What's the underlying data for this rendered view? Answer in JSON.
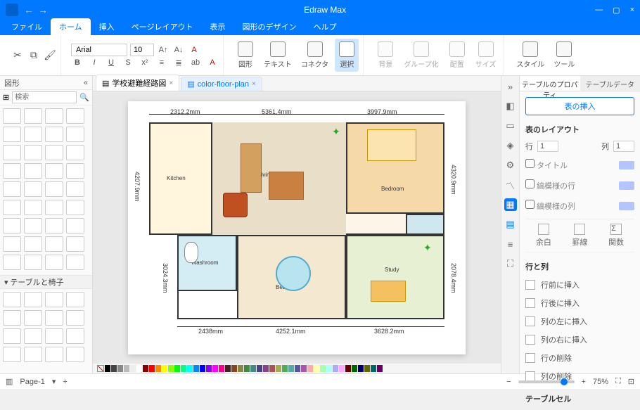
{
  "app": {
    "title": "Edraw Max"
  },
  "window_controls": {
    "minimize": "—",
    "restore": "▢",
    "close": "×"
  },
  "menu": {
    "tabs": [
      "ファイル",
      "ホーム",
      "挿入",
      "ページレイアウト",
      "表示",
      "図形のデザイン",
      "ヘルプ"
    ],
    "active": 1
  },
  "ribbon": {
    "font_name": "Arial",
    "font_size": "10",
    "format_buttons": [
      "B",
      "I",
      "U",
      "S",
      "x²",
      "x₂",
      "A"
    ],
    "big_tools": [
      {
        "label": "図形"
      },
      {
        "label": "テキスト"
      },
      {
        "label": "コネクタ"
      },
      {
        "label": "選択",
        "active": true
      }
    ],
    "arrange_tools": [
      {
        "label": "背景"
      },
      {
        "label": "グループ化"
      },
      {
        "label": "配置"
      },
      {
        "label": "サイズ"
      }
    ],
    "right_tools": [
      {
        "label": "スタイル"
      },
      {
        "label": "ツール"
      }
    ]
  },
  "left_panel": {
    "title": "図形",
    "search_placeholder": "検索",
    "section2": "テーブルと椅子"
  },
  "doc_tabs": [
    {
      "icon": "doc",
      "label": "学校避難経路図",
      "active": false
    },
    {
      "icon": "doc",
      "label": "color-floor-plan",
      "active": true
    }
  ],
  "floorplan": {
    "dims_top": [
      "2312.2mm",
      "5361.4mm",
      "3997.9mm"
    ],
    "dims_bottom": [
      "2438mm",
      "4252.1mm",
      "3628.2mm"
    ],
    "dim_left": "4207.9mm",
    "dim_left2": "3024.3mm",
    "dim_right": "4320.9mm",
    "dim_right2": "2078.4mm",
    "rooms": {
      "kitchen": "Kitchen",
      "living": "Living Room",
      "bedroom1": "Bedroom",
      "washroom": "Washroom",
      "bedroom2": "Bedroom",
      "study": "Study"
    }
  },
  "right_rail_icons": [
    "expand",
    "theme",
    "style",
    "layers",
    "settings",
    "chart",
    "table",
    "page",
    "align",
    "fullscreen"
  ],
  "right_panel": {
    "tabs": [
      "テーブルのプロパティ",
      "テーブルデータ"
    ],
    "active_tab": 0,
    "insert_btn": "表の挿入",
    "layout_header": "表のレイアウト",
    "rows_label": "行",
    "rows_value": "1",
    "cols_label": "列",
    "cols_value": "1",
    "checks": [
      {
        "label": "タイトル"
      },
      {
        "label": "縞模様の行"
      },
      {
        "label": "縞模様の列"
      }
    ],
    "icons3": [
      {
        "label": "余白"
      },
      {
        "label": "罫線"
      },
      {
        "label": "関数"
      }
    ],
    "rowcol_header": "行と列",
    "rowcol_ops": [
      "行前に挿入",
      "行後に挿入",
      "列の左に挿入",
      "列の右に挿入",
      "行の削除",
      "列の削除"
    ],
    "cell_header": "テーブルセル"
  },
  "statusbar": {
    "page_label": "Page-1",
    "add_page": "+",
    "zoom": "75%"
  },
  "color_palette": [
    "#000",
    "#444",
    "#888",
    "#bbb",
    "#eee",
    "#fff",
    "#800",
    "#f00",
    "#f80",
    "#ff0",
    "#8f0",
    "#0f0",
    "#0f8",
    "#0ff",
    "#08f",
    "#00f",
    "#80f",
    "#f0f",
    "#f08",
    "#422",
    "#842",
    "#884",
    "#484",
    "#488",
    "#448",
    "#848",
    "#a55",
    "#aa5",
    "#5a5",
    "#5aa",
    "#55a",
    "#a5a",
    "#faa",
    "#ffa",
    "#afa",
    "#aff",
    "#aaf",
    "#faf",
    "#600",
    "#060",
    "#006",
    "#660",
    "#066",
    "#606"
  ]
}
